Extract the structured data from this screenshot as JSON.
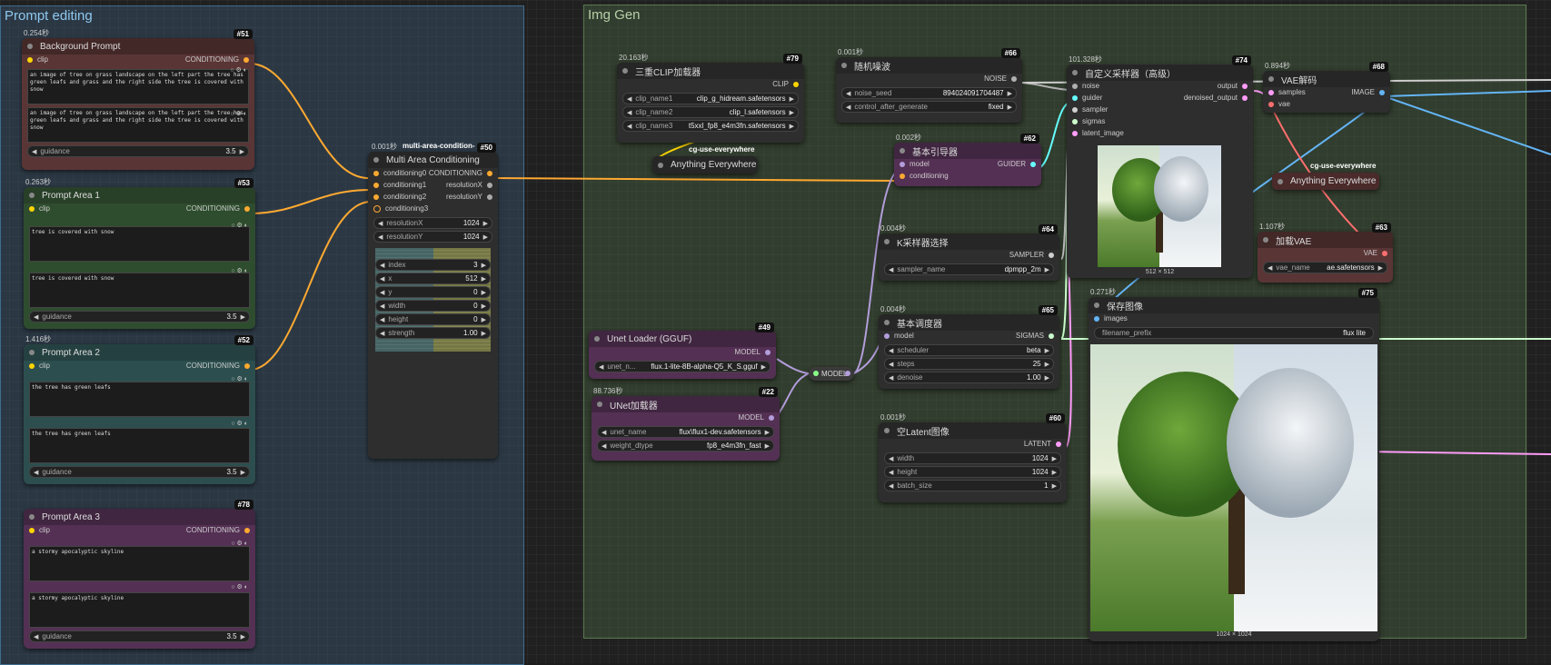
{
  "groups": {
    "prompt_editing": "Prompt editing",
    "img_gen": "Img Gen"
  },
  "colors": {
    "conditioning": "#ffa931",
    "clip": "#ffd500",
    "model": "#b39ddb",
    "latent": "#ff9cf9",
    "vae": "#ff6e6e",
    "image": "#64b5f6",
    "noise": "#b0b0b0",
    "sigmas": "#cdffcd",
    "guider": "#66ffff"
  },
  "nodes": {
    "bg_prompt": {
      "badge": "#51",
      "time": "0.254秒",
      "title": "Background Prompt",
      "in_clip": "clip",
      "out": "CONDITIONING",
      "text1": "an image of tree on grass landscape on the left part the tree has green leafs and grass and the right side the tree is covered with snow",
      "text2": "an image of tree on grass landscape on the left part the tree has green leafs and grass and the right side the tree is covered with snow",
      "guidance_label": "guidance",
      "guidance_value": "3.5"
    },
    "area1": {
      "badge": "#53",
      "time": "0.263秒",
      "title": "Prompt Area 1",
      "in_clip": "clip",
      "out": "CONDITIONING",
      "text1": "tree is covered with snow",
      "text2": "tree is covered with snow",
      "guidance_label": "guidance",
      "guidance_value": "3.5"
    },
    "area2": {
      "badge": "#52",
      "time": "1.416秒",
      "title": "Prompt Area 2",
      "in_clip": "clip",
      "out": "CONDITIONING",
      "text1": "the tree has green leafs",
      "text2": "the tree has green leafs",
      "guidance_label": "guidance",
      "guidance_value": "3.5"
    },
    "area3": {
      "badge": "#78",
      "title": "Prompt Area 3",
      "in_clip": "clip",
      "out": "CONDITIONING",
      "text1": "a stormy apocalyptic skyline",
      "text2": "a stormy apocalyptic skyline",
      "guidance_label": "guidance",
      "guidance_value": "3.5"
    },
    "multi_area": {
      "badge": "#50",
      "time": "0.001秒",
      "tag": "multi-area-condition-",
      "title": "Multi Area Conditioning",
      "inputs": [
        "conditioning0",
        "conditioning1",
        "conditioning2",
        "conditioning3"
      ],
      "outputs": [
        "CONDITIONING",
        "resolutionX",
        "resolutionY"
      ],
      "widgets": [
        {
          "label": "resolutionX",
          "value": "1024"
        },
        {
          "label": "resolutionY",
          "value": "1024"
        }
      ],
      "params": [
        {
          "label": "index",
          "value": "3"
        },
        {
          "label": "x",
          "value": "512"
        },
        {
          "label": "y",
          "value": "0"
        },
        {
          "label": "width",
          "value": "0"
        },
        {
          "label": "height",
          "value": "0"
        },
        {
          "label": "strength",
          "value": "1.00"
        }
      ]
    },
    "triple_clip": {
      "badge": "#79",
      "time": "20.163秒",
      "title": "三重CLIP加载器",
      "out": "CLIP",
      "widgets": [
        {
          "label": "clip_name1",
          "value": "clip_g_hidream.safetensors"
        },
        {
          "label": "clip_name2",
          "value": "clip_l.safetensors"
        },
        {
          "label": "clip_name3",
          "value": "t5xxl_fp8_e4m3fn.safetensors"
        }
      ]
    },
    "cg_use_1": {
      "label": "cg-use-everywhere",
      "title": "Anything Everywhere"
    },
    "rand_noise": {
      "badge": "#66",
      "time": "0.001秒",
      "title": "随机噪波",
      "out": "NOISE",
      "widgets": [
        {
          "label": "noise_seed",
          "value": "894024091704487"
        },
        {
          "label": "control_after_generate",
          "value": "fixed"
        }
      ]
    },
    "basic_guider": {
      "badge": "#62",
      "time": "0.002秒",
      "title": "基本引导器",
      "inputs": [
        "model",
        "conditioning"
      ],
      "out": "GUIDER"
    },
    "ksampler_select": {
      "badge": "#64",
      "time": "0.004秒",
      "title": "K采样器选择",
      "out": "SAMPLER",
      "widgets": [
        {
          "label": "sampler_name",
          "value": "dpmpp_2m"
        }
      ]
    },
    "basic_sched": {
      "badge": "#65",
      "time": "0.004秒",
      "title": "基本调度器",
      "in": "model",
      "out": "SIGMAS",
      "widgets": [
        {
          "label": "scheduler",
          "value": "beta"
        },
        {
          "label": "steps",
          "value": "25"
        },
        {
          "label": "denoise",
          "value": "1.00"
        }
      ]
    },
    "empty_latent": {
      "badge": "#60",
      "time": "0.001秒",
      "title": "空Latent图像",
      "out": "LATENT",
      "widgets": [
        {
          "label": "width",
          "value": "1024"
        },
        {
          "label": "height",
          "value": "1024"
        },
        {
          "label": "batch_size",
          "value": "1"
        }
      ]
    },
    "unet_gguf": {
      "badge": "#49",
      "title": "Unet Loader (GGUF)",
      "out": "MODEL",
      "widgets": [
        {
          "label": "unet_n...",
          "value": "flux.1-lite-8B-alpha-Q5_K_S.gguf"
        }
      ]
    },
    "unet_loader": {
      "badge": "#22",
      "time": "88.736秒",
      "title": "UNet加载器",
      "out": "MODEL",
      "widgets": [
        {
          "label": "unet_name",
          "value": "flux\\flux1-dev.safetensors"
        },
        {
          "label": "weight_dtype",
          "value": "fp8_e4m3fn_fast"
        }
      ]
    },
    "reroute_model": {
      "label": "MODEL"
    },
    "custom_sampler": {
      "badge": "#74",
      "time": "101.328秒",
      "title": "自定义采样器（高级）",
      "inputs": [
        "noise",
        "guider",
        "sampler",
        "sigmas",
        "latent_image"
      ],
      "outputs": [
        "output",
        "denoised_output"
      ],
      "preview_caption": "512 × 512"
    },
    "vae_decode": {
      "badge": "#68",
      "time": "0.894秒",
      "title": "VAE解码",
      "inputs": [
        "samples",
        "vae"
      ],
      "out": "IMAGE"
    },
    "cg_use_2": {
      "label": "cg-use-everywhere",
      "title": "Anything Everywhere"
    },
    "vae_loader": {
      "badge": "#63",
      "time": "1.107秒",
      "title": "加载VAE",
      "out": "VAE",
      "widgets": [
        {
          "label": "vae_name",
          "value": "ae.safetensors"
        }
      ]
    },
    "save_image": {
      "badge": "#75",
      "time": "0.271秒",
      "title": "保存图像",
      "in": "images",
      "widgets": [
        {
          "label": "filename_prefix",
          "value": "flux lite"
        }
      ],
      "caption": "1024 × 1024"
    }
  }
}
